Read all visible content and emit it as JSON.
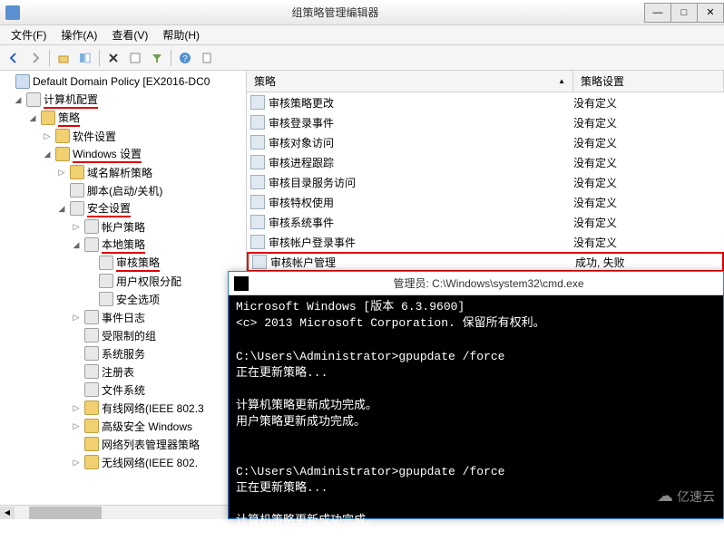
{
  "window": {
    "title": "组策略管理编辑器",
    "min": "—",
    "max": "□",
    "close": "✕"
  },
  "menubar": {
    "file": "文件(F)",
    "action": "操作(A)",
    "view": "查看(V)",
    "help": "帮助(H)"
  },
  "tree": {
    "root": "Default Domain Policy [EX2016-DC0",
    "computer_config": "计算机配置",
    "policies": "策略",
    "software_settings": "软件设置",
    "windows_settings": "Windows 设置",
    "name_resolution": "域名解析策略",
    "scripts": "脚本(启动/关机)",
    "security_settings": "安全设置",
    "account_policies": "帐户策略",
    "local_policies": "本地策略",
    "audit_policy": "审核策略",
    "user_rights": "用户权限分配",
    "security_options": "安全选项",
    "event_log": "事件日志",
    "restricted_groups": "受限制的组",
    "system_services": "系统服务",
    "registry": "注册表",
    "file_system": "文件系统",
    "wired_network": "有线网络(IEEE 802.3",
    "advanced_security": "高级安全 Windows",
    "network_list": "网络列表管理器策略",
    "wireless_network": "无线网络(IEEE 802."
  },
  "list": {
    "header_policy": "策略",
    "header_setting": "策略设置",
    "rows": [
      {
        "policy": "审核策略更改",
        "setting": "没有定义"
      },
      {
        "policy": "审核登录事件",
        "setting": "没有定义"
      },
      {
        "policy": "审核对象访问",
        "setting": "没有定义"
      },
      {
        "policy": "审核进程跟踪",
        "setting": "没有定义"
      },
      {
        "policy": "审核目录服务访问",
        "setting": "没有定义"
      },
      {
        "policy": "审核特权使用",
        "setting": "没有定义"
      },
      {
        "policy": "审核系统事件",
        "setting": "没有定义"
      },
      {
        "policy": "审核帐户登录事件",
        "setting": "没有定义"
      },
      {
        "policy": "审核帐户管理",
        "setting": "成功, 失败"
      }
    ]
  },
  "cmd": {
    "title": "管理员: C:\\Windows\\system32\\cmd.exe",
    "body": "Microsoft Windows [版本 6.3.9600]\n<c> 2013 Microsoft Corporation. 保留所有权利。\n\nC:\\Users\\Administrator>gpupdate /force\n正在更新策略...\n\n计算机策略更新成功完成。\n用户策略更新成功完成。\n\n\nC:\\Users\\Administrator>gpupdate /force\n正在更新策略...\n\n计算机策略更新成功完成。\n用户策略更新成功完成。"
  },
  "watermark": "亿速云"
}
